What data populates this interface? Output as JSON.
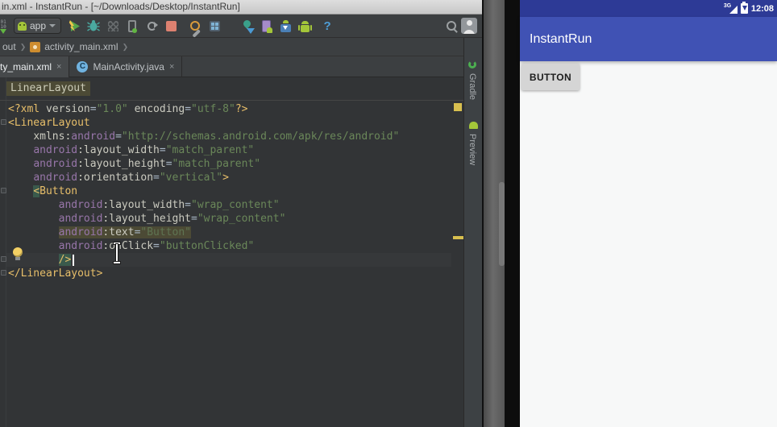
{
  "window": {
    "title": "in.xml - InstantRun - [~/Downloads/Desktop/InstantRun]"
  },
  "toolbar": {
    "run_config": "app",
    "help_label": "?",
    "make_bits_top": "01",
    "make_bits_bottom": "10"
  },
  "breadcrumbs": {
    "items": [
      "out",
      "activity_main.xml"
    ],
    "separator": "❯"
  },
  "tabs": [
    {
      "label": "ty_main.xml",
      "close": "×"
    },
    {
      "label": "MainActivity.java",
      "close": "×",
      "icon_letter": "C"
    }
  ],
  "editor": {
    "breadcrumb_chip": "LinearLayout",
    "code": {
      "lines": [
        {
          "segs": [
            {
              "t": "<?xml ",
              "c": "tag"
            },
            {
              "t": "version",
              "c": "attr"
            },
            {
              "t": "=",
              "c": "eq"
            },
            {
              "t": "\"1.0\"",
              "c": "str"
            },
            {
              "t": " ",
              "c": "eq"
            },
            {
              "t": "encoding",
              "c": "attr"
            },
            {
              "t": "=",
              "c": "eq"
            },
            {
              "t": "\"utf-8\"",
              "c": "str"
            },
            {
              "t": "?>",
              "c": "tag"
            }
          ]
        },
        {
          "segs": [
            {
              "t": "<LinearLayout",
              "c": "tag"
            }
          ]
        },
        {
          "segs": [
            {
              "t": "    ",
              "c": "eq"
            },
            {
              "t": "xmlns:",
              "c": "attr"
            },
            {
              "t": "android",
              "c": "ns"
            },
            {
              "t": "=",
              "c": "eq"
            },
            {
              "t": "\"http://schemas.android.com/apk/res/android\"",
              "c": "str"
            }
          ]
        },
        {
          "segs": [
            {
              "t": "    ",
              "c": "eq"
            },
            {
              "t": "android",
              "c": "ns"
            },
            {
              "t": ":layout_width",
              "c": "attr"
            },
            {
              "t": "=",
              "c": "eq"
            },
            {
              "t": "\"match_parent\"",
              "c": "str"
            }
          ]
        },
        {
          "segs": [
            {
              "t": "    ",
              "c": "eq"
            },
            {
              "t": "android",
              "c": "ns"
            },
            {
              "t": ":layout_height",
              "c": "attr"
            },
            {
              "t": "=",
              "c": "eq"
            },
            {
              "t": "\"match_parent\"",
              "c": "str"
            }
          ]
        },
        {
          "segs": [
            {
              "t": "    ",
              "c": "eq"
            },
            {
              "t": "android",
              "c": "ns"
            },
            {
              "t": ":orientation",
              "c": "attr"
            },
            {
              "t": "=",
              "c": "eq"
            },
            {
              "t": "\"vertical\"",
              "c": "str"
            },
            {
              "t": ">",
              "c": "tag"
            }
          ]
        },
        {
          "segs": [
            {
              "t": "    ",
              "c": "eq"
            },
            {
              "t": "<",
              "c": "tag",
              "hl": "teal"
            },
            {
              "t": "Button",
              "c": "tag"
            }
          ]
        },
        {
          "segs": [
            {
              "t": "        ",
              "c": "eq"
            },
            {
              "t": "android",
              "c": "ns"
            },
            {
              "t": ":layout_width",
              "c": "attr"
            },
            {
              "t": "=",
              "c": "eq"
            },
            {
              "t": "\"wrap_content\"",
              "c": "str"
            }
          ]
        },
        {
          "segs": [
            {
              "t": "        ",
              "c": "eq"
            },
            {
              "t": "android",
              "c": "ns"
            },
            {
              "t": ":layout_height",
              "c": "attr"
            },
            {
              "t": "=",
              "c": "eq"
            },
            {
              "t": "\"wrap_content\"",
              "c": "str"
            }
          ]
        },
        {
          "segs": [
            {
              "t": "        ",
              "c": "eq"
            },
            {
              "t": "android",
              "c": "ns",
              "hl": "khaki"
            },
            {
              "t": ":text",
              "c": "attr",
              "hl": "khaki"
            },
            {
              "t": "=",
              "c": "eq",
              "hl": "khaki"
            },
            {
              "t": "\"Button\"",
              "c": "strdim",
              "hl": "khaki"
            }
          ]
        },
        {
          "segs": [
            {
              "t": "        ",
              "c": "eq"
            },
            {
              "t": "android",
              "c": "ns"
            },
            {
              "t": ":onClick",
              "c": "attr"
            },
            {
              "t": "=",
              "c": "eq"
            },
            {
              "t": "\"buttonClicked\"",
              "c": "str"
            }
          ]
        },
        {
          "current": true,
          "segs": [
            {
              "t": "        ",
              "c": "eq"
            },
            {
              "t": "/>",
              "c": "tag",
              "hl": "teal"
            }
          ]
        },
        {
          "segs": [
            {
              "t": "</LinearLayout>",
              "c": "tag"
            }
          ]
        }
      ]
    }
  },
  "tool_windows": {
    "right": [
      {
        "label": "Gradle"
      },
      {
        "label": "Preview"
      }
    ]
  },
  "emulator": {
    "status_bar": {
      "network": "3G",
      "time": "12:08"
    },
    "app_bar_title": "InstantRun",
    "button_label": "BUTTON"
  },
  "colors": {
    "chrome_bg": "#3C3F41",
    "editor_bg": "#323436",
    "status_bar": "#2D3A96",
    "app_bar": "#4052B4",
    "tag": "#E8BF6A",
    "namespace": "#9876AA",
    "string": "#6A8759",
    "highlight_khaki": "#4C4A35",
    "highlight_teal": "#3A5A4C",
    "stop_button": "#DD8170",
    "android_green": "#A4C639",
    "warning_stripe": "#D8BF4F"
  }
}
